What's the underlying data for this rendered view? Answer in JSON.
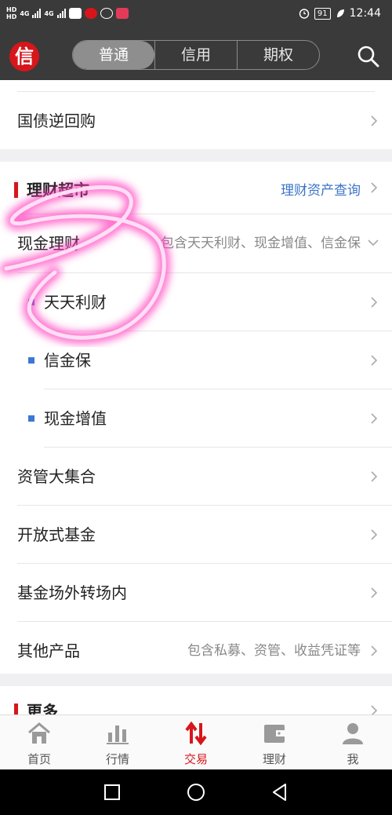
{
  "status_bar": {
    "network_1": "4G",
    "network_2": "4G",
    "battery": "91",
    "time": "12:44"
  },
  "header": {
    "logo_char": "信",
    "segments": [
      "普通",
      "信用",
      "期权"
    ]
  },
  "content": {
    "repo_row": "国债逆回购",
    "section_title": "理财超市",
    "section_link": "理财资产查询",
    "cash_row": {
      "label": "现金理财",
      "desc": "包含天天利财、现金增值、信金保"
    },
    "sub_items": [
      "天天利财",
      "信金保",
      "现金增值"
    ],
    "rows": [
      "资管大集合",
      "开放式基金",
      "基金场外转场内"
    ],
    "other_row": {
      "label": "其他产品",
      "desc": "包含私募、资管、收益凭证等"
    },
    "more_title": "更多"
  },
  "tabbar": {
    "items": [
      "首页",
      "行情",
      "交易",
      "理财",
      "我"
    ],
    "active": "交易"
  },
  "colors": {
    "brand_red": "#d6161b",
    "link_blue": "#3b74c9",
    "bullet_blue": "#3b77d6",
    "header_bg": "#3a3a3a",
    "scribble_pink": "#ff2aa8"
  }
}
